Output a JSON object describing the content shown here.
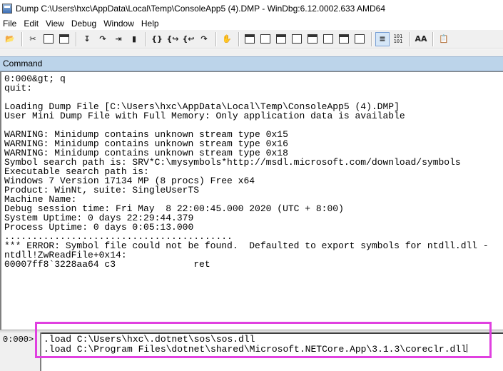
{
  "window": {
    "title": "Dump C:\\Users\\hxc\\AppData\\Local\\Temp\\ConsoleApp5 (4).DMP - WinDbg:6.12.0002.633 AMD64"
  },
  "menu": {
    "items": [
      "File",
      "Edit",
      "View",
      "Debug",
      "Window",
      "Help"
    ]
  },
  "toolbar": {
    "icons": [
      "open-icon",
      "cut-icon",
      "copy-icon",
      "paste-icon",
      "step-into-icon",
      "step-over-icon",
      "go-icon",
      "break-icon",
      "step-out-icon",
      "run-to-cursor-icon",
      "run-icon",
      "hand-icon",
      "command-window-icon",
      "watch-window-icon",
      "locals-window-icon",
      "registers-window-icon",
      "memory-window-icon",
      "call-stack-icon",
      "disassembly-icon",
      "scratch-pad-icon",
      "source-mode-icon",
      "hex-mode-icon",
      "font-icon",
      "options-icon"
    ],
    "hex_label_top": "101",
    "hex_label_bottom": "101",
    "font_label": "AA"
  },
  "command_window": {
    "header": "Command",
    "output": "0:000&gt; q\nquit:\n\nLoading Dump File [C:\\Users\\hxc\\AppData\\Local\\Temp\\ConsoleApp5 (4).DMP]\nUser Mini Dump File with Full Memory: Only application data is available\n\nWARNING: Minidump contains unknown stream type 0x15\nWARNING: Minidump contains unknown stream type 0x16\nWARNING: Minidump contains unknown stream type 0x18\nSymbol search path is: SRV*C:\\mysymbols*http://msdl.microsoft.com/download/symbols\nExecutable search path is:\nWindows 7 Version 17134 MP (8 procs) Free x64\nProduct: WinNt, suite: SingleUserTS\nMachine Name:\nDebug session time: Fri May  8 22:00:45.000 2020 (UTC + 8:00)\nSystem Uptime: 0 days 22:29:44.379\nProcess Uptime: 0 days 0:05:13.000\n.........................................\n*** ERROR: Symbol file could not be found.  Defaulted to export symbols for ntdll.dll -\nntdll!ZwReadFile+0x14:\n00007ff8`3228aa64 c3              ret",
    "prompt": "0:000>",
    "input": ".load C:\\Users\\hxc\\.dotnet\\sos\\sos.dll\n.load C:\\Program Files\\dotnet\\shared\\Microsoft.NETCore.App\\3.1.3\\coreclr.dll"
  },
  "colors": {
    "highlight_border": "#e040e0",
    "header_bg": "#bcd4ea"
  }
}
